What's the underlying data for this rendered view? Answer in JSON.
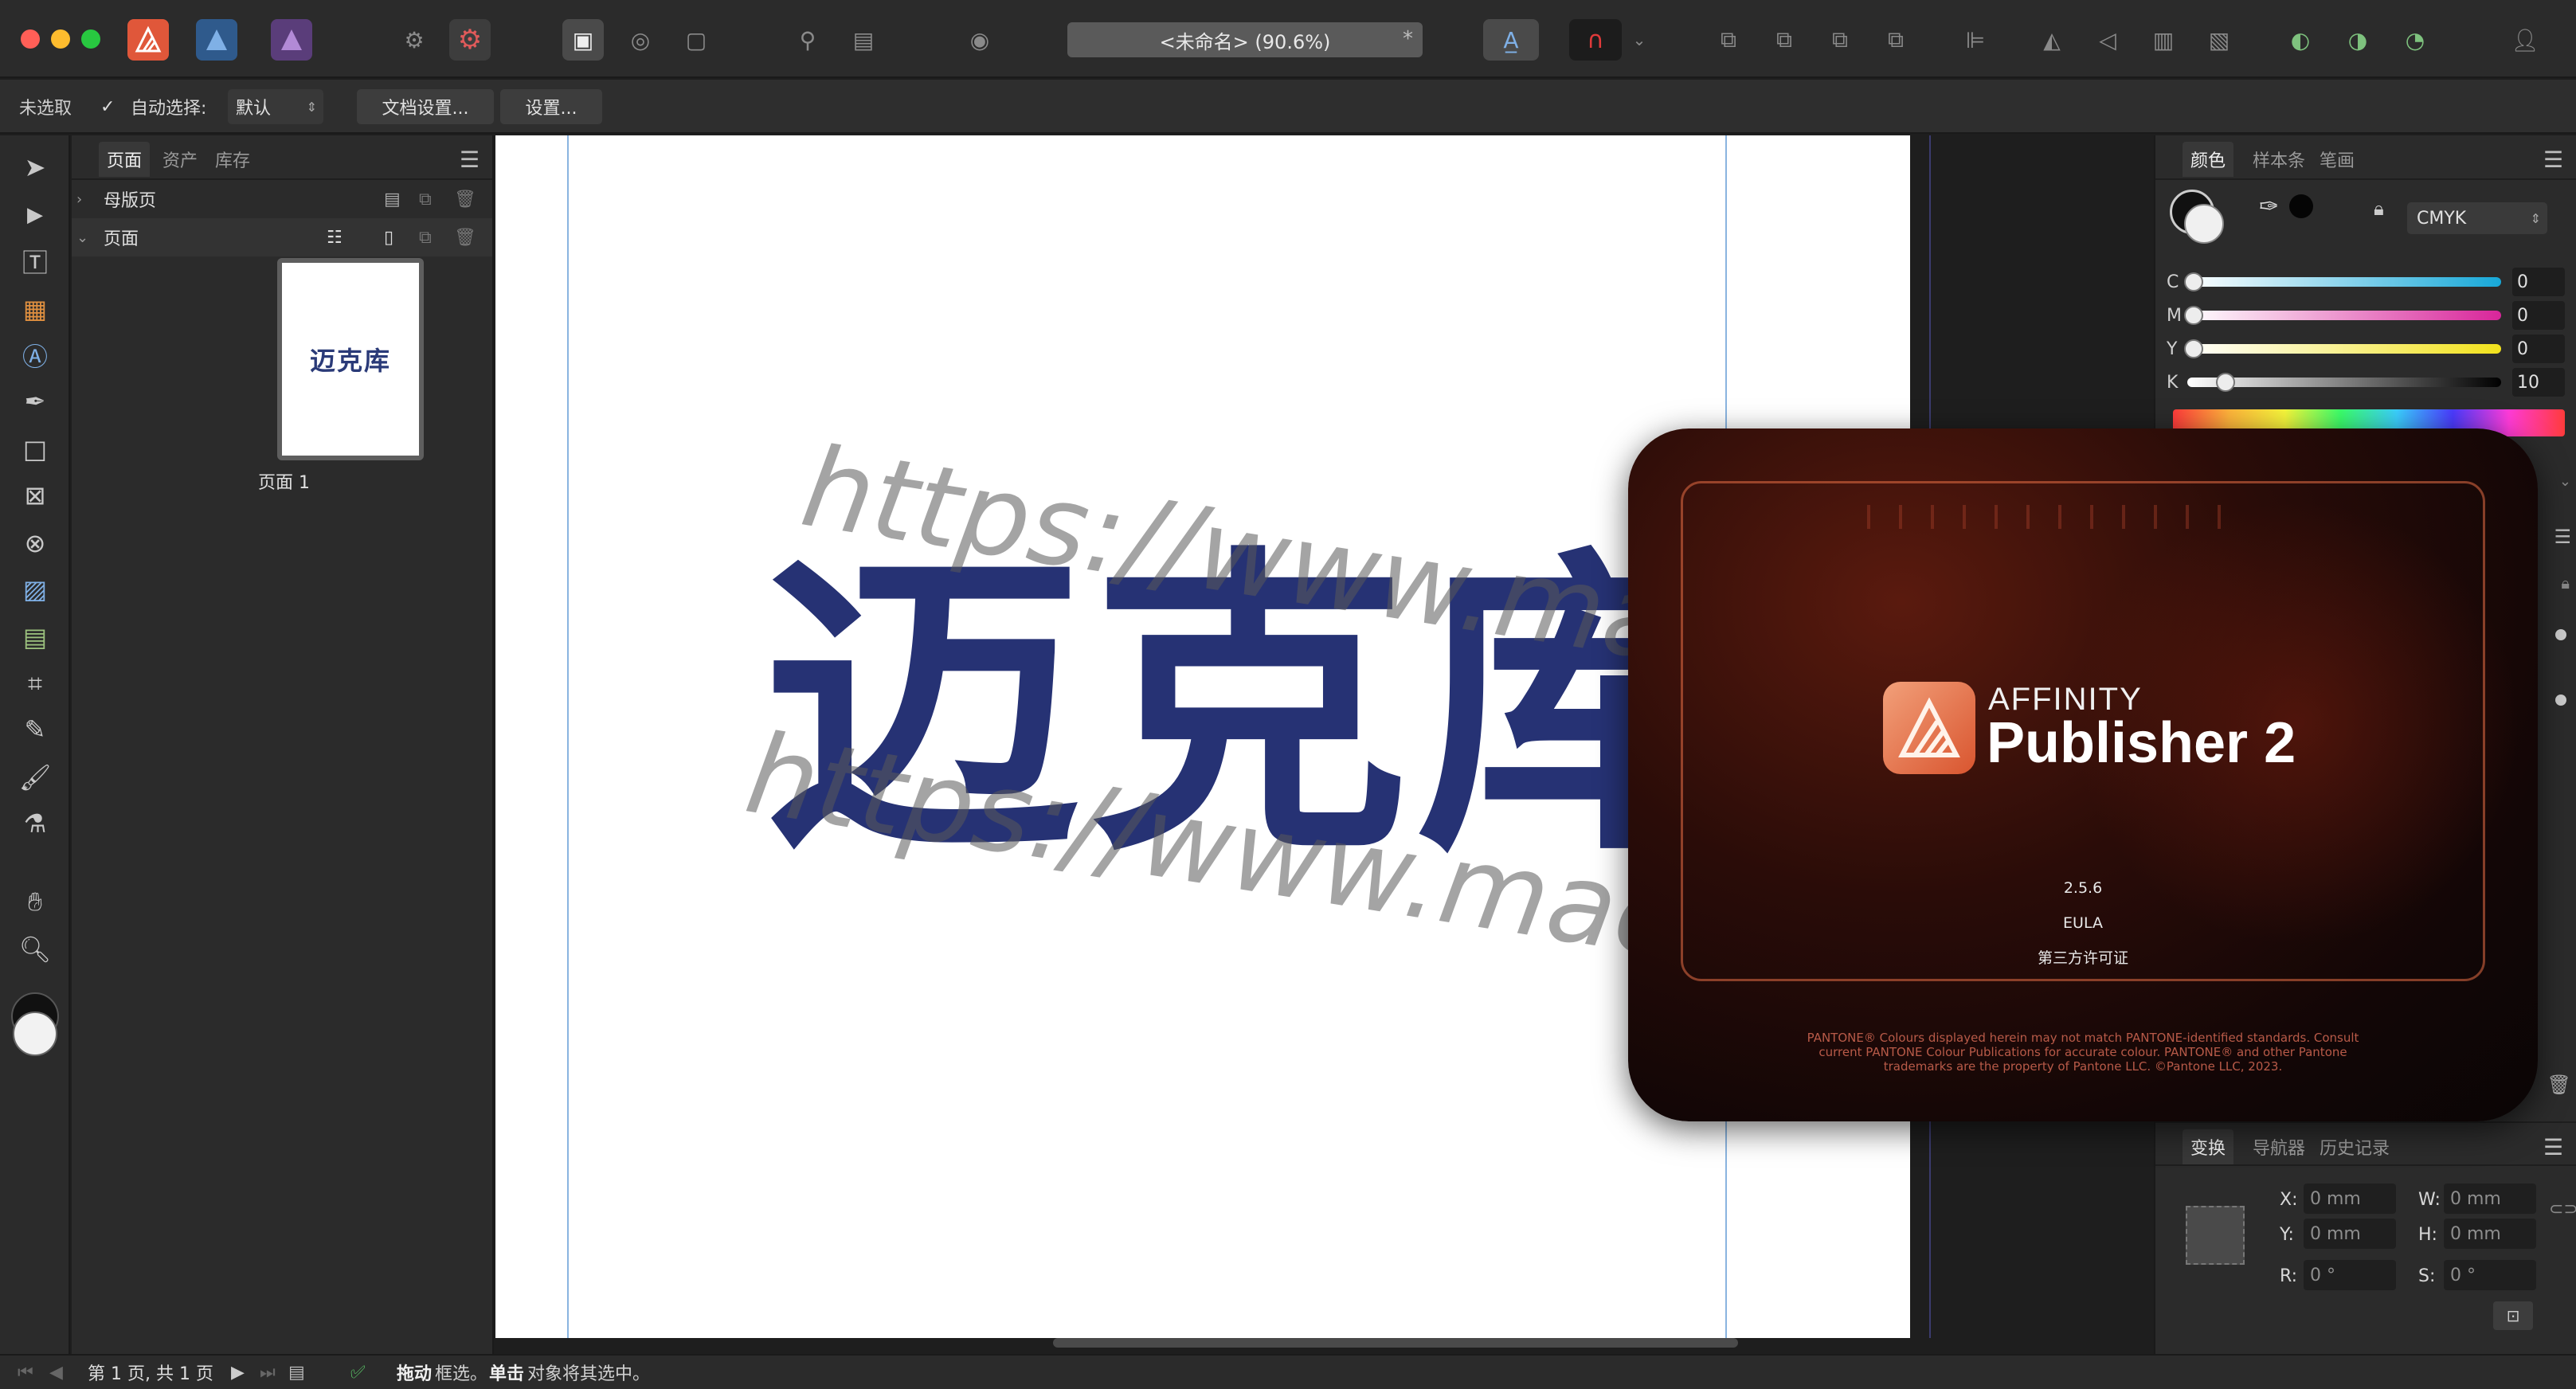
{
  "titlebar": {
    "doc_title": "<未命名> (90.6%)",
    "modified_marker": "*"
  },
  "context": {
    "selection_status": "未选取",
    "auto_select_label": "自动选择:",
    "auto_select_value": "默认",
    "doc_setup_button": "文档设置...",
    "settings_button": "设置..."
  },
  "pages_panel": {
    "tabs": [
      "页面",
      "资产",
      "库存"
    ],
    "master_pages": "母版页",
    "pages": "页面",
    "thumb_text": "迈克库",
    "thumb_label": "页面 1"
  },
  "canvas": {
    "logo_text": "迈克库",
    "watermark": "https://www.macku.pro/"
  },
  "color_panel": {
    "tabs": [
      "颜色",
      "样本条",
      "笔画"
    ],
    "model": "CMYK",
    "channels": [
      {
        "letter": "C",
        "value": "0"
      },
      {
        "letter": "M",
        "value": "0"
      },
      {
        "letter": "Y",
        "value": "0"
      },
      {
        "letter": "K",
        "value": "10"
      }
    ]
  },
  "transform_panel": {
    "tabs": [
      "变换",
      "导航器",
      "历史记录"
    ],
    "x_label": "X:",
    "x_value": "0 mm",
    "y_label": "Y:",
    "y_value": "0 mm",
    "w_label": "W:",
    "w_value": "0 mm",
    "h_label": "H:",
    "h_value": "0 mm",
    "r_label": "R:",
    "r_value": "0 °",
    "s_label": "S:",
    "s_value": "0 °"
  },
  "splash": {
    "brand": "AFFINITY",
    "product": "Publisher 2",
    "version": "2.5.6",
    "eula": "EULA",
    "third_party": "第三方许可证",
    "legal": "PANTONE® Colours displayed herein may not match PANTONE-identified standards. Consult current PANTONE Colour Publications for accurate colour. PANTONE® and other Pantone trademarks are the property of Pantone LLC. ©Pantone LLC, 2023."
  },
  "status": {
    "page_info": "第 1 页, 共 1 页",
    "drag_bold": "拖动",
    "drag_text": "框选。",
    "click_bold": "单击",
    "click_text": "对象将其选中。"
  },
  "colors": {
    "logo_blue": "#263274",
    "accent_orange": "#d9552f",
    "panel_bg": "#2b2b2b"
  }
}
